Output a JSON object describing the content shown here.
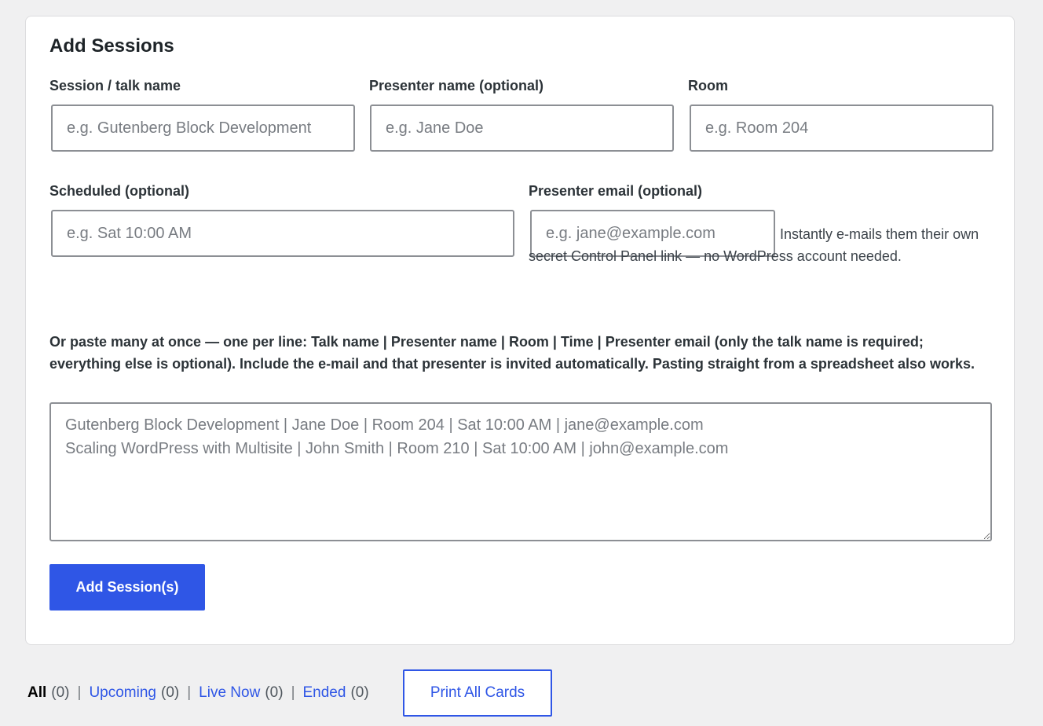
{
  "form": {
    "title": "Add Sessions",
    "session": {
      "label": "Session / talk name",
      "placeholder": "e.g. Gutenberg Block Development"
    },
    "presenter": {
      "label": "Presenter name (optional)",
      "placeholder": "e.g. Jane Doe"
    },
    "room": {
      "label": "Room",
      "placeholder": "e.g. Room 204"
    },
    "scheduled": {
      "label": "Scheduled (optional)",
      "placeholder": "e.g. Sat 10:00 AM"
    },
    "email": {
      "label": "Presenter email (optional)",
      "placeholder": "e.g. jane@example.com",
      "hint": "Instantly e-mails them their own secret Control Panel link — no WordPress account needed."
    },
    "bulk": {
      "help": "Or paste many at once — one per line: Talk name | Presenter name | Room | Time | Presenter email (only the talk name is required; everything else is optional). Include the e-mail and that presenter is invited automatically. Pasting straight from a spreadsheet also works.",
      "placeholder": "Gutenberg Block Development | Jane Doe | Room 204 | Sat 10:00 AM | jane@example.com\nScaling WordPress with Multisite | John Smith | Room 210 | Sat 10:00 AM | john@example.com"
    },
    "submit_label": "Add Session(s)"
  },
  "filters": {
    "all": {
      "label": "All",
      "count": "(0)"
    },
    "upcoming": {
      "label": "Upcoming",
      "count": "(0)"
    },
    "live": {
      "label": "Live Now",
      "count": "(0)"
    },
    "ended": {
      "label": "Ended",
      "count": "(0)"
    },
    "separator": "|"
  },
  "print_label": "Print All Cards",
  "colors": {
    "accent": "#2f56e6",
    "background": "#f0f0f1",
    "card": "#ffffff"
  }
}
